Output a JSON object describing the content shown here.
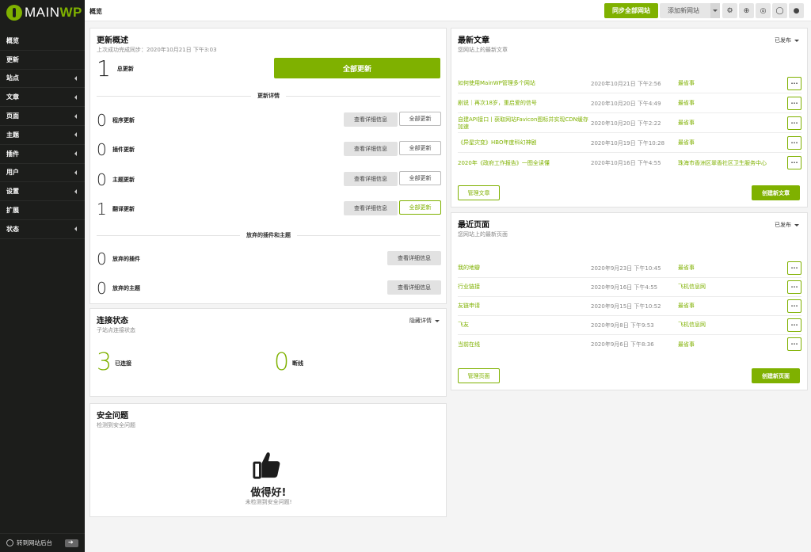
{
  "sidebar": {
    "logo_main": "MAIN",
    "logo_wp": "WP",
    "items": [
      {
        "label": "概览",
        "caret": false
      },
      {
        "label": "更新",
        "caret": false
      },
      {
        "label": "站点",
        "caret": true
      },
      {
        "label": "文章",
        "caret": true
      },
      {
        "label": "页面",
        "caret": true
      },
      {
        "label": "主题",
        "caret": true
      },
      {
        "label": "插件",
        "caret": true
      },
      {
        "label": "用户",
        "caret": true
      },
      {
        "label": "设置",
        "caret": true
      },
      {
        "label": "扩展",
        "caret": false
      },
      {
        "label": "状态",
        "caret": true
      }
    ],
    "bottom_label": "转到网站后台"
  },
  "topbar": {
    "title": "概览",
    "sync_label": "同步全部网站",
    "add_site_label": "添加新网站",
    "icons": [
      "gear-icon",
      "globe-icon",
      "help-icon",
      "chat-icon",
      "user-icon"
    ]
  },
  "updates": {
    "title": "更新概述",
    "subtitle": "上次成功完成同步：2020年10月21日 下午3:03",
    "total_num": "1",
    "total_label": "总更新",
    "update_all_label": "全部更新",
    "details_title": "更新详情",
    "rows": [
      {
        "num": "0",
        "label": "程序更新",
        "detail": "查看详细信息",
        "all": "全部更新",
        "active": false
      },
      {
        "num": "0",
        "label": "插件更新",
        "detail": "查看详细信息",
        "all": "全部更新",
        "active": false
      },
      {
        "num": "0",
        "label": "主题更新",
        "detail": "查看详细信息",
        "all": "全部更新",
        "active": false
      },
      {
        "num": "1",
        "label": "翻译更新",
        "detail": "查看详细信息",
        "all": "全部更新",
        "active": true
      }
    ],
    "abandoned_title": "放弃的插件和主题",
    "abandoned": [
      {
        "num": "0",
        "label": "放弃的插件",
        "detail": "查看详细信息"
      },
      {
        "num": "0",
        "label": "放弃的主题",
        "detail": "查看详细信息"
      }
    ]
  },
  "connection": {
    "title": "连接状态",
    "subtitle": "子站点连接状态",
    "hide_label": "隐藏详情",
    "connected_num": "3",
    "connected_label": "已连接",
    "disconnected_num": "0",
    "disconnected_label": "断线"
  },
  "security": {
    "title": "安全问题",
    "subtitle": "检测到安全问题",
    "good": "做得好!",
    "good_sub": "未检测到安全问题!"
  },
  "posts": {
    "title": "最新文章",
    "subtitle": "您网站上的最新文章",
    "filter": "已发布",
    "rows": [
      {
        "title": "如何使用MainWP管理多个网站",
        "date": "2020年10月21日 下午2:56",
        "author": "最省事"
      },
      {
        "title": "剧说｜再次18岁，重启爱的信号",
        "date": "2020年10月20日 下午4:49",
        "author": "最省事"
      },
      {
        "title": "自建API接口丨获取网站Favicon图标并实现CDN缓存加速",
        "date": "2020年10月20日 下午2:22",
        "author": "最省事"
      },
      {
        "title": "《异星灾变》HBO年度科幻神剧",
        "date": "2020年10月19日 下午10:28",
        "author": "最省事"
      },
      {
        "title": "2020年《政府工作报告》一图全读懂",
        "date": "2020年10月16日 下午4:55",
        "author": "珠海市香洲区翠香社区卫生服务中心"
      }
    ],
    "manage_label": "管理文章",
    "create_label": "创建新文章"
  },
  "pages": {
    "title": "最近页面",
    "subtitle": "您网站上的最新页面",
    "filter": "已发布",
    "rows": [
      {
        "title": "我的地瓣",
        "date": "2020年9月23日 下午10:45",
        "author": "最省事"
      },
      {
        "title": "行业链接",
        "date": "2020年9月16日 下午4:55",
        "author": "飞机信息网"
      },
      {
        "title": "友链申请",
        "date": "2020年9月15日 下午10:52",
        "author": "最省事"
      },
      {
        "title": "飞友",
        "date": "2020年9月8日 下午9:53",
        "author": "飞机信息网"
      },
      {
        "title": "当前在线",
        "date": "2020年9月6日 下午8:36",
        "author": "最省事"
      }
    ],
    "manage_label": "管理页面",
    "create_label": "创建新页面"
  },
  "row_action": "···"
}
